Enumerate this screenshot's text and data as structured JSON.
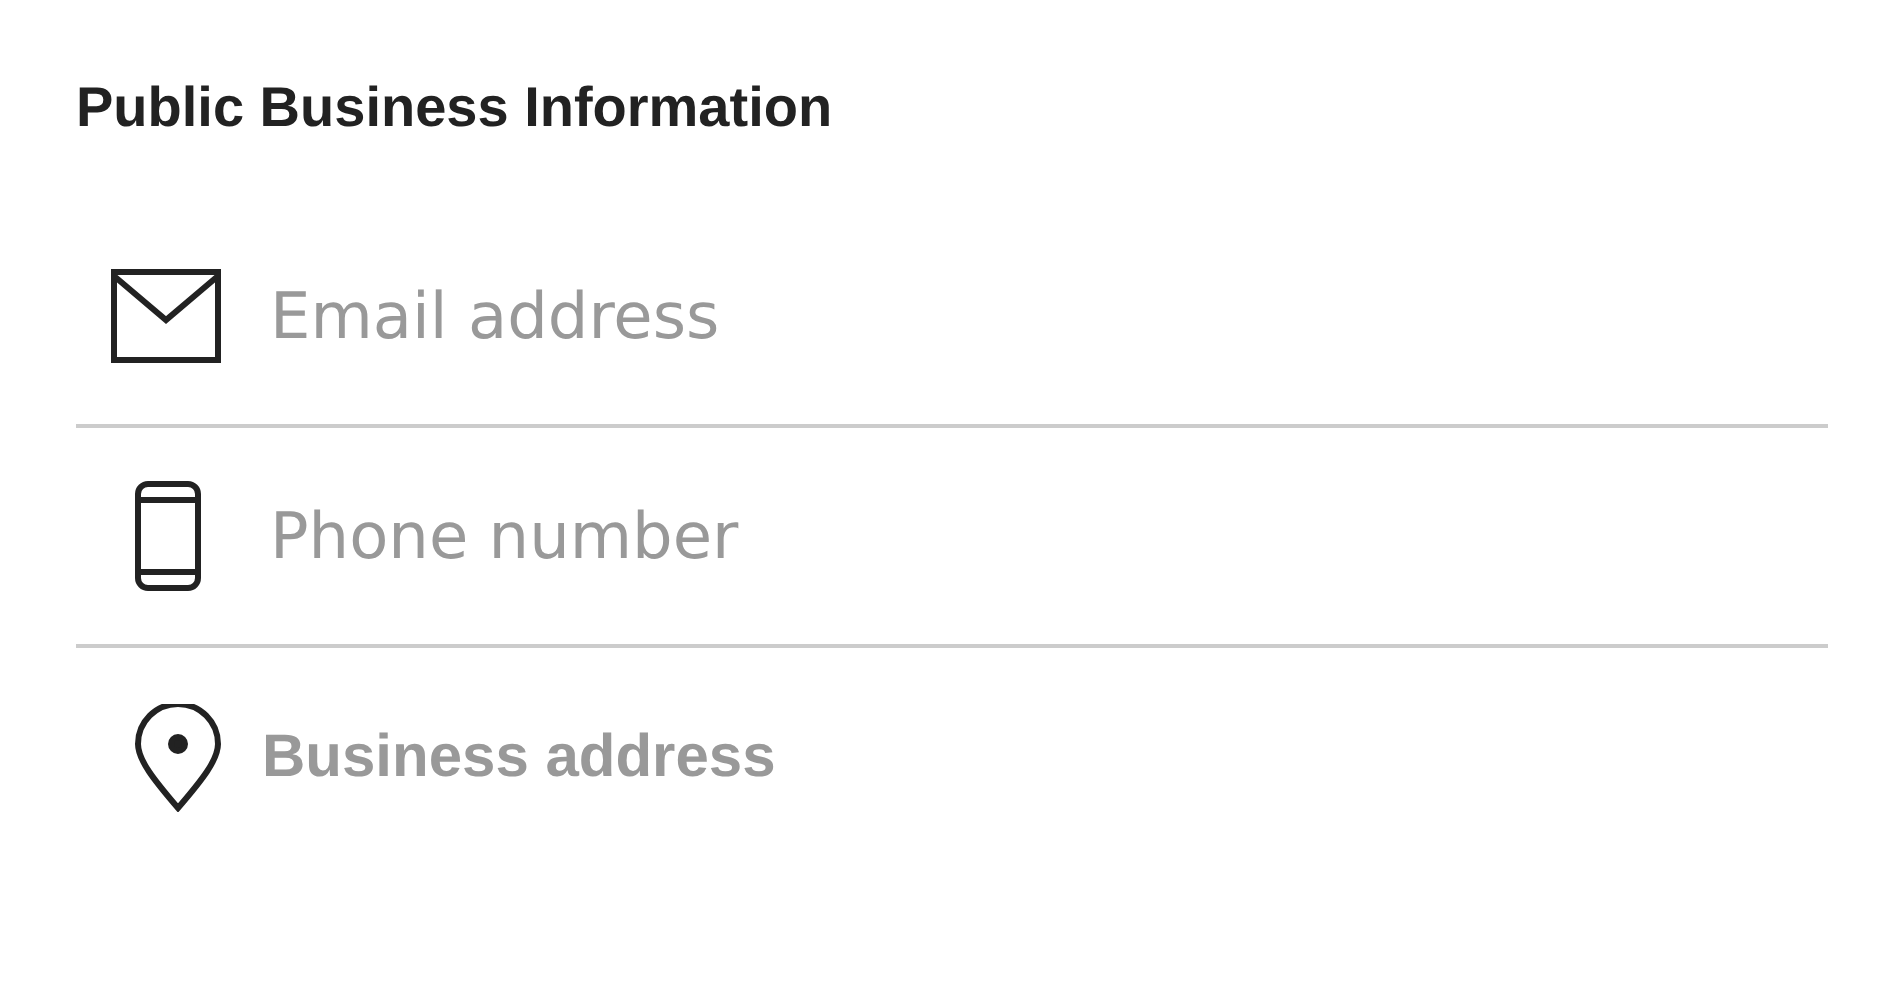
{
  "section": {
    "title": "Public Business Information"
  },
  "fields": [
    {
      "kind": "email",
      "placeholder": "Email address"
    },
    {
      "kind": "phone",
      "placeholder": "Phone number"
    },
    {
      "kind": "address",
      "label": "Business address"
    }
  ]
}
